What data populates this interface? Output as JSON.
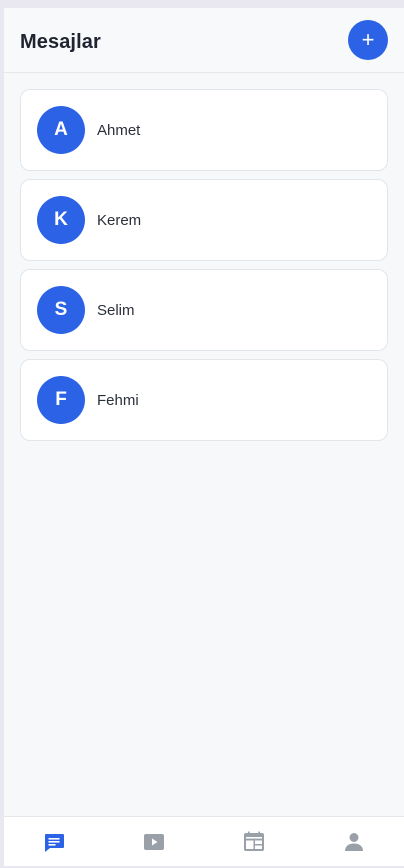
{
  "header": {
    "title": "Mesajlar",
    "add_label": "+"
  },
  "conversations": [
    {
      "initial": "A",
      "name": "Ahmet"
    },
    {
      "initial": "K",
      "name": "Kerem"
    },
    {
      "initial": "S",
      "name": "Selim"
    },
    {
      "initial": "F",
      "name": "Fehmi"
    }
  ],
  "tabbar": {
    "items": [
      {
        "icon": "chat-icon",
        "active": true
      },
      {
        "icon": "video-icon",
        "active": false
      },
      {
        "icon": "calendar-icon",
        "active": false
      },
      {
        "icon": "person-icon",
        "active": false
      }
    ]
  },
  "colors": {
    "accent": "#2c63e6",
    "tab_inactive": "#9aa0a8",
    "background": "#f7f8fa"
  }
}
